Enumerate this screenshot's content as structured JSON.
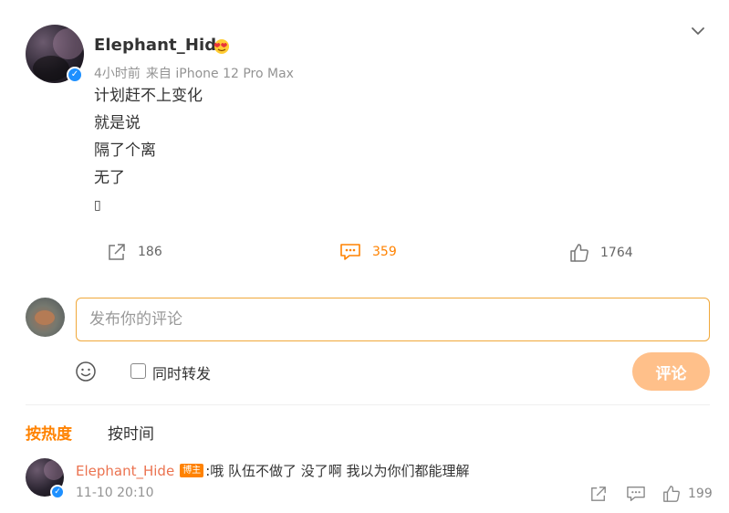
{
  "post": {
    "username": "Elephant_Hide",
    "time": "4小时前",
    "source": "来自 iPhone 12 Pro Max",
    "verified_mark": "✓",
    "content_lines": [
      "计划赶不上变化",
      "就是说",
      "隔了个离",
      "无了",
      "▯"
    ],
    "actions": {
      "repost_count": "186",
      "comment_count": "359",
      "like_count": "1764"
    }
  },
  "composer": {
    "placeholder": "发布你的评论",
    "value": "",
    "repost_label": "同时转发",
    "submit_label": "评论"
  },
  "sort_tabs": {
    "hot": "按热度",
    "time": "按时间"
  },
  "comments": [
    {
      "username": "Elephant_Hide",
      "badge": "博主",
      "text": ":哦 队伍不做了 没了啊 我以为你们都能理解",
      "time": "11-10 20:10",
      "like_count": "199"
    }
  ],
  "colors": {
    "accent": "#ff8200",
    "submit_disabled": "#ffc08a",
    "comment_user": "#eb7350",
    "verified": "#1e90ff"
  }
}
